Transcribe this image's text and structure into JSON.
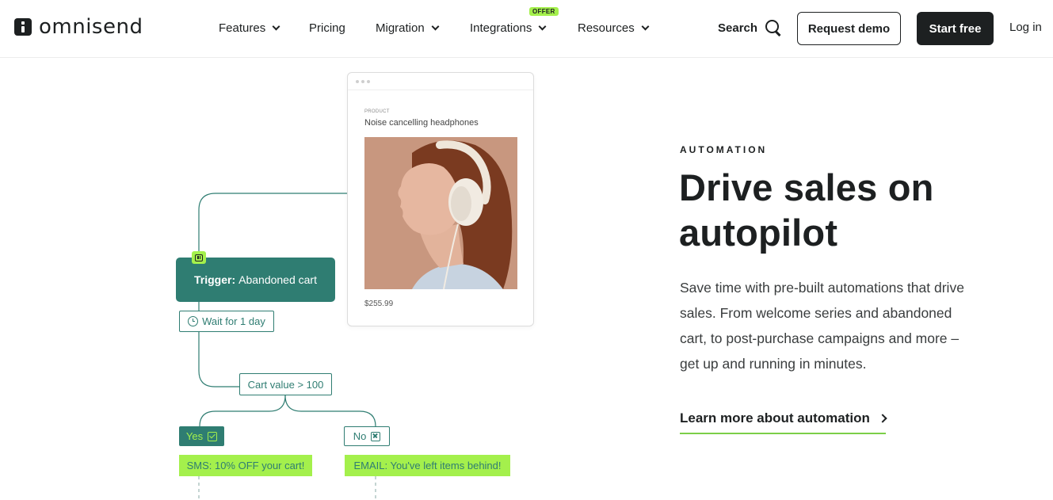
{
  "brand": {
    "name": "omnisend"
  },
  "nav": {
    "items": [
      {
        "label": "Features"
      },
      {
        "label": "Pricing"
      },
      {
        "label": "Migration"
      },
      {
        "label": "Integrations"
      },
      {
        "label": "Resources"
      }
    ],
    "offer_badge": "OFFER",
    "search_label": "Search",
    "request_demo": "Request demo",
    "start_free": "Start free",
    "login": "Log in"
  },
  "illustration": {
    "product_label": "PRODUCT",
    "product_name": "Noise cancelling headphones",
    "product_price": "$255.99",
    "trigger_prefix": "Trigger:",
    "trigger_value": "Abandoned cart",
    "wait": "Wait for 1 day",
    "condition": "Cart value > 100",
    "yes_label": "Yes",
    "no_label": "No",
    "sms_action": "SMS: 10% OFF your cart!",
    "email_action": "EMAIL: You've left items behind!"
  },
  "hero": {
    "eyebrow": "AUTOMATION",
    "headline": "Drive sales on autopilot",
    "body": "Save time with pre-built automations that drive sales. From welcome series and abandoned cart, to post-purchase campaigns and more – get up and running in minutes.",
    "link": "Learn more about automation"
  },
  "colors": {
    "dark": "#1d2021",
    "teal": "#2f7d72",
    "lime": "#a4f04c"
  }
}
